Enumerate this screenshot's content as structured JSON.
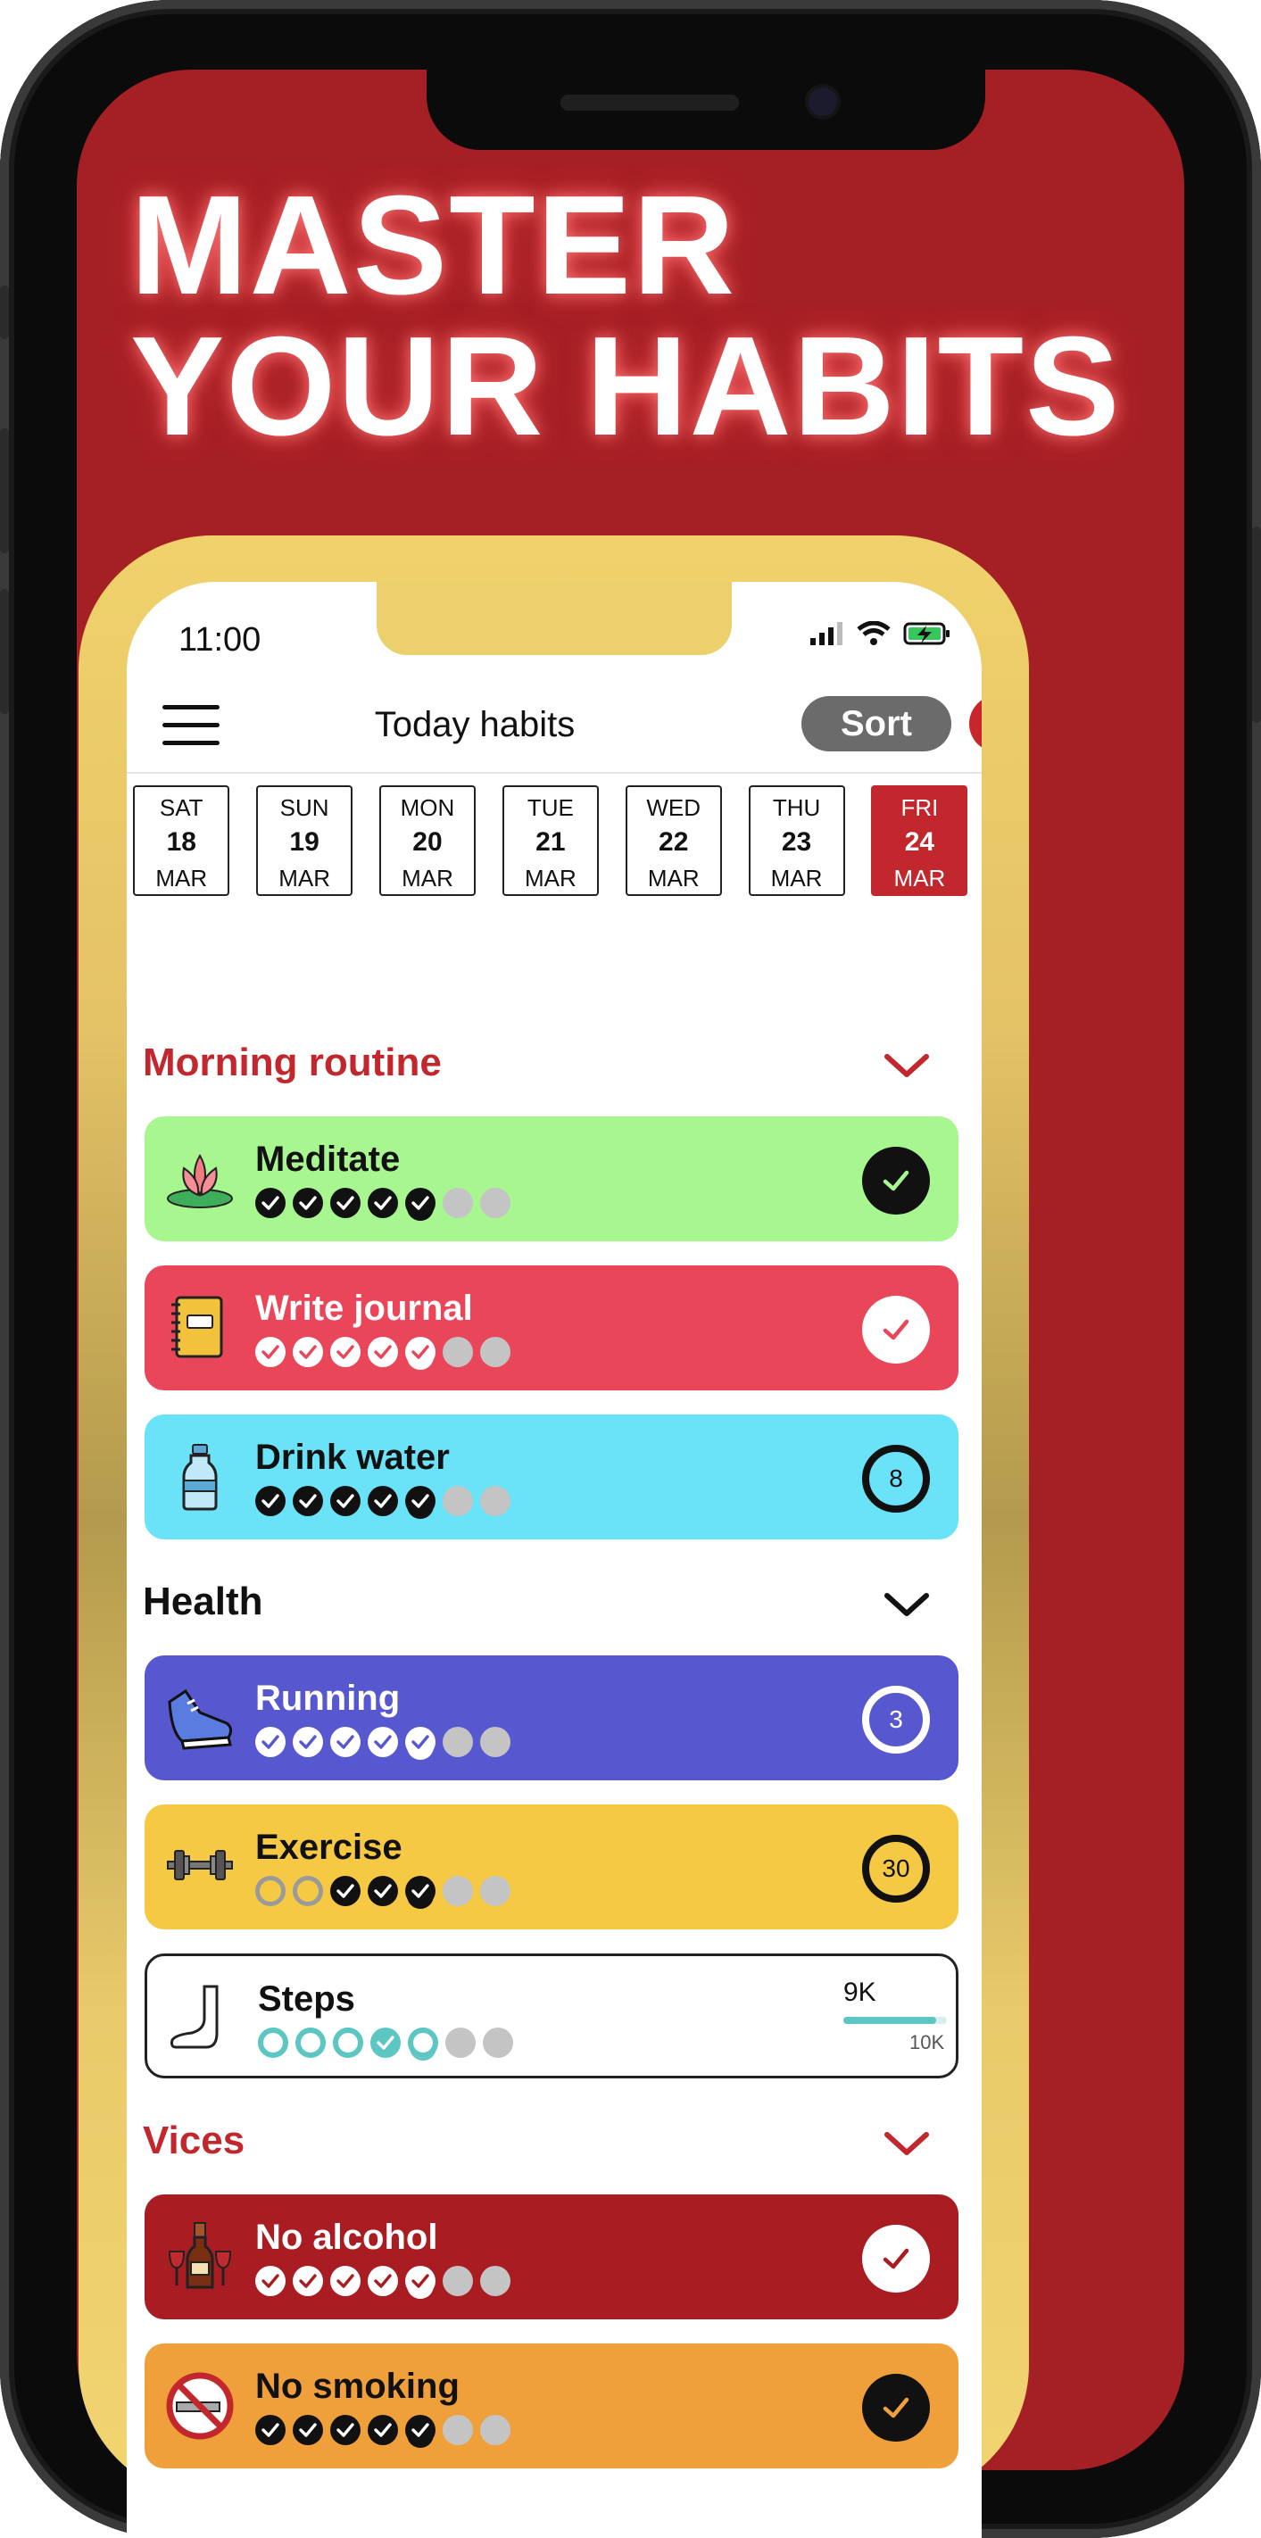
{
  "headline": {
    "line1": "MASTER",
    "line2": "YOUR HABITS"
  },
  "statusbar": {
    "time": "11:00"
  },
  "header": {
    "title": "Today habits",
    "sort_label": "Sort",
    "menu_icon": "hamburger-menu-icon",
    "add_icon": "plus-icon"
  },
  "days": [
    {
      "weekday": "SAT",
      "day": "18",
      "month": "MAR",
      "selected": false
    },
    {
      "weekday": "SUN",
      "day": "19",
      "month": "MAR",
      "selected": false
    },
    {
      "weekday": "MON",
      "day": "20",
      "month": "MAR",
      "selected": false
    },
    {
      "weekday": "TUE",
      "day": "21",
      "month": "MAR",
      "selected": false
    },
    {
      "weekday": "WED",
      "day": "22",
      "month": "MAR",
      "selected": false
    },
    {
      "weekday": "THU",
      "day": "23",
      "month": "MAR",
      "selected": false
    },
    {
      "weekday": "FRI",
      "day": "24",
      "month": "MAR",
      "selected": true
    }
  ],
  "sections": [
    {
      "title": "Morning routine",
      "color": "#c1272d"
    },
    {
      "title": "Health",
      "color": "#111111"
    },
    {
      "title": "Vices",
      "color": "#c1272d"
    }
  ],
  "habits": [
    {
      "name": "Meditate",
      "icon": "lotus-icon",
      "bg": "#a8f690",
      "text": "#111111",
      "status": "done",
      "value": ""
    },
    {
      "name": "Write journal",
      "icon": "journal-icon",
      "bg": "#e9465a",
      "text": "#ffffff",
      "status": "done",
      "value": ""
    },
    {
      "name": "Drink water",
      "icon": "water-bottle-icon",
      "bg": "#6ae2f8",
      "text": "#111111",
      "status": "count",
      "value": "8"
    },
    {
      "name": "Running",
      "icon": "running-shoe-icon",
      "bg": "#5757cf",
      "text": "#ffffff",
      "status": "count",
      "value": "3"
    },
    {
      "name": "Exercise",
      "icon": "dumbbell-icon",
      "bg": "#f6c945",
      "text": "#111111",
      "status": "count",
      "value": "30"
    },
    {
      "name": "Steps",
      "icon": "foot-icon",
      "bg": "#ffffff",
      "text": "#111111",
      "status": "progress",
      "value": "9K",
      "goal": "10K",
      "progress": 0.9
    },
    {
      "name": "No alcohol",
      "icon": "wine-bottle-icon",
      "bg": "#a81c22",
      "text": "#ffffff",
      "status": "done",
      "value": ""
    },
    {
      "name": "No smoking",
      "icon": "no-smoking-icon",
      "bg": "#f0a03a",
      "text": "#111111",
      "status": "done",
      "value": ""
    }
  ],
  "colors": {
    "brand_red": "#a52025",
    "gold": "#e4c266",
    "teal": "#5cc6c2"
  }
}
